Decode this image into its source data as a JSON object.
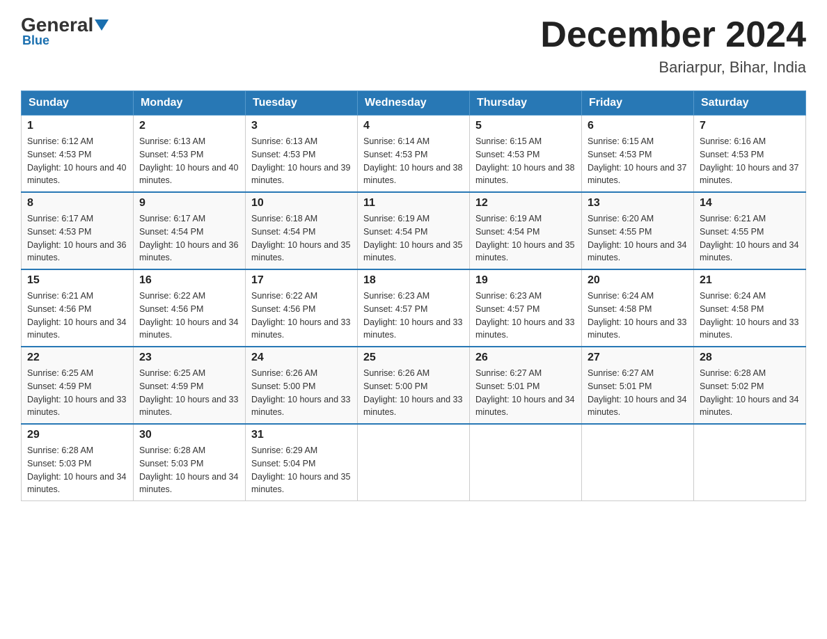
{
  "header": {
    "logo_general": "General",
    "logo_blue": "Blue",
    "month_title": "December 2024",
    "location": "Bariarpur, Bihar, India"
  },
  "days_of_week": [
    "Sunday",
    "Monday",
    "Tuesday",
    "Wednesday",
    "Thursday",
    "Friday",
    "Saturday"
  ],
  "weeks": [
    [
      {
        "num": "1",
        "sunrise": "6:12 AM",
        "sunset": "4:53 PM",
        "daylight": "10 hours and 40 minutes."
      },
      {
        "num": "2",
        "sunrise": "6:13 AM",
        "sunset": "4:53 PM",
        "daylight": "10 hours and 40 minutes."
      },
      {
        "num": "3",
        "sunrise": "6:13 AM",
        "sunset": "4:53 PM",
        "daylight": "10 hours and 39 minutes."
      },
      {
        "num": "4",
        "sunrise": "6:14 AM",
        "sunset": "4:53 PM",
        "daylight": "10 hours and 38 minutes."
      },
      {
        "num": "5",
        "sunrise": "6:15 AM",
        "sunset": "4:53 PM",
        "daylight": "10 hours and 38 minutes."
      },
      {
        "num": "6",
        "sunrise": "6:15 AM",
        "sunset": "4:53 PM",
        "daylight": "10 hours and 37 minutes."
      },
      {
        "num": "7",
        "sunrise": "6:16 AM",
        "sunset": "4:53 PM",
        "daylight": "10 hours and 37 minutes."
      }
    ],
    [
      {
        "num": "8",
        "sunrise": "6:17 AM",
        "sunset": "4:53 PM",
        "daylight": "10 hours and 36 minutes."
      },
      {
        "num": "9",
        "sunrise": "6:17 AM",
        "sunset": "4:54 PM",
        "daylight": "10 hours and 36 minutes."
      },
      {
        "num": "10",
        "sunrise": "6:18 AM",
        "sunset": "4:54 PM",
        "daylight": "10 hours and 35 minutes."
      },
      {
        "num": "11",
        "sunrise": "6:19 AM",
        "sunset": "4:54 PM",
        "daylight": "10 hours and 35 minutes."
      },
      {
        "num": "12",
        "sunrise": "6:19 AM",
        "sunset": "4:54 PM",
        "daylight": "10 hours and 35 minutes."
      },
      {
        "num": "13",
        "sunrise": "6:20 AM",
        "sunset": "4:55 PM",
        "daylight": "10 hours and 34 minutes."
      },
      {
        "num": "14",
        "sunrise": "6:21 AM",
        "sunset": "4:55 PM",
        "daylight": "10 hours and 34 minutes."
      }
    ],
    [
      {
        "num": "15",
        "sunrise": "6:21 AM",
        "sunset": "4:56 PM",
        "daylight": "10 hours and 34 minutes."
      },
      {
        "num": "16",
        "sunrise": "6:22 AM",
        "sunset": "4:56 PM",
        "daylight": "10 hours and 34 minutes."
      },
      {
        "num": "17",
        "sunrise": "6:22 AM",
        "sunset": "4:56 PM",
        "daylight": "10 hours and 33 minutes."
      },
      {
        "num": "18",
        "sunrise": "6:23 AM",
        "sunset": "4:57 PM",
        "daylight": "10 hours and 33 minutes."
      },
      {
        "num": "19",
        "sunrise": "6:23 AM",
        "sunset": "4:57 PM",
        "daylight": "10 hours and 33 minutes."
      },
      {
        "num": "20",
        "sunrise": "6:24 AM",
        "sunset": "4:58 PM",
        "daylight": "10 hours and 33 minutes."
      },
      {
        "num": "21",
        "sunrise": "6:24 AM",
        "sunset": "4:58 PM",
        "daylight": "10 hours and 33 minutes."
      }
    ],
    [
      {
        "num": "22",
        "sunrise": "6:25 AM",
        "sunset": "4:59 PM",
        "daylight": "10 hours and 33 minutes."
      },
      {
        "num": "23",
        "sunrise": "6:25 AM",
        "sunset": "4:59 PM",
        "daylight": "10 hours and 33 minutes."
      },
      {
        "num": "24",
        "sunrise": "6:26 AM",
        "sunset": "5:00 PM",
        "daylight": "10 hours and 33 minutes."
      },
      {
        "num": "25",
        "sunrise": "6:26 AM",
        "sunset": "5:00 PM",
        "daylight": "10 hours and 33 minutes."
      },
      {
        "num": "26",
        "sunrise": "6:27 AM",
        "sunset": "5:01 PM",
        "daylight": "10 hours and 34 minutes."
      },
      {
        "num": "27",
        "sunrise": "6:27 AM",
        "sunset": "5:01 PM",
        "daylight": "10 hours and 34 minutes."
      },
      {
        "num": "28",
        "sunrise": "6:28 AM",
        "sunset": "5:02 PM",
        "daylight": "10 hours and 34 minutes."
      }
    ],
    [
      {
        "num": "29",
        "sunrise": "6:28 AM",
        "sunset": "5:03 PM",
        "daylight": "10 hours and 34 minutes."
      },
      {
        "num": "30",
        "sunrise": "6:28 AM",
        "sunset": "5:03 PM",
        "daylight": "10 hours and 34 minutes."
      },
      {
        "num": "31",
        "sunrise": "6:29 AM",
        "sunset": "5:04 PM",
        "daylight": "10 hours and 35 minutes."
      },
      null,
      null,
      null,
      null
    ]
  ]
}
